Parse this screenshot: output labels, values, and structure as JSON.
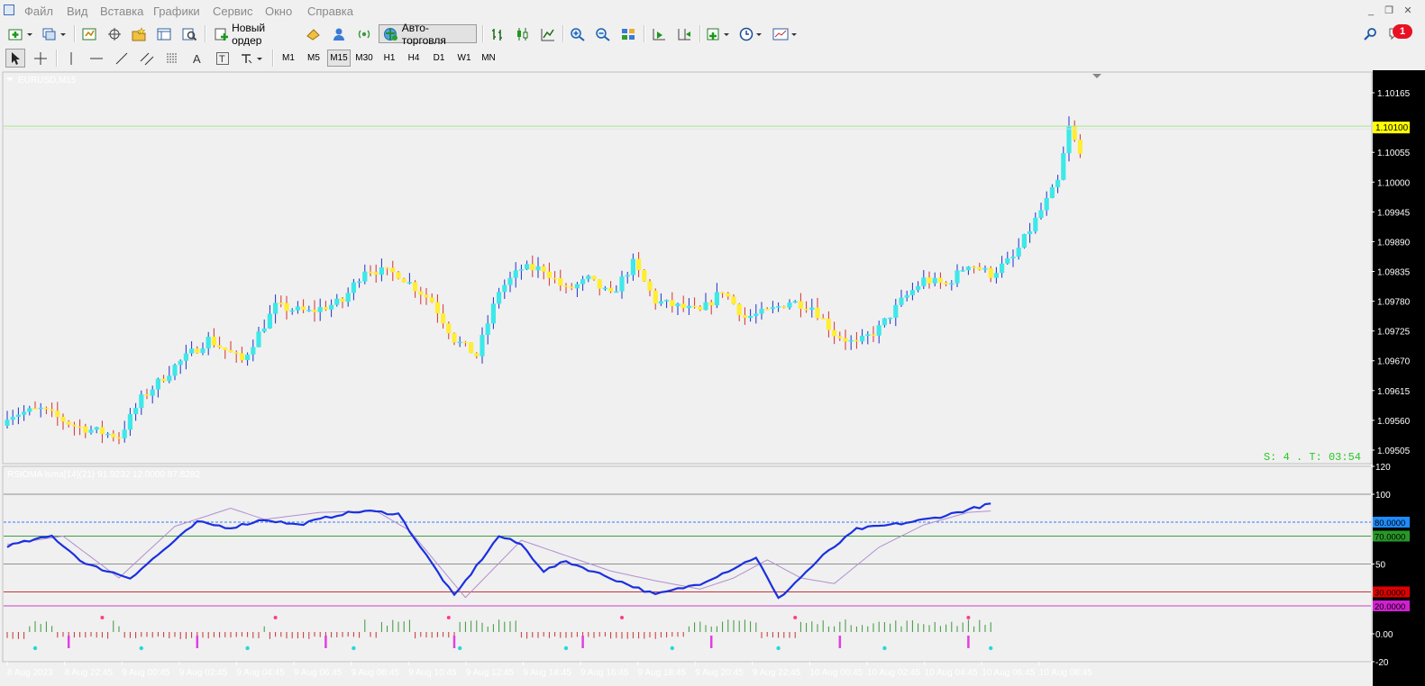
{
  "menu": [
    "Файл",
    "Вид",
    "Вставка",
    "Графики",
    "Сервис",
    "Окно",
    "Справка"
  ],
  "toolbar": {
    "new_order_label": "Новый ордер",
    "autotrading_label": "Авто-торговля",
    "notification_count": "1"
  },
  "timeframes": [
    "M1",
    "M5",
    "M15",
    "M30",
    "H1",
    "H4",
    "D1",
    "W1",
    "MN"
  ],
  "active_timeframe": "M15",
  "chart": {
    "symbol_label": "EURUSD,M15",
    "price_ticks": [
      "1.10165",
      "1.10055",
      "1.10000",
      "1.09945",
      "1.09890",
      "1.09835",
      "1.09780",
      "1.09725",
      "1.09670",
      "1.09615",
      "1.09560",
      "1.09505"
    ],
    "current_price": "1.10100",
    "price_min": 1.0948,
    "price_max": 1.102,
    "spread_timer": "S: 4 .  T: 03:54",
    "colors": {
      "bull": "#3ee8e8",
      "bear": "#ffee33",
      "bull_wick": "#2030d0",
      "bear_wick": "#d83030",
      "price_line": "#a8e890",
      "label_bg": "#ffff00"
    }
  },
  "indicator": {
    "label": "RSIOMA lsma[14](21) 91.9232 12.0000 87.8282",
    "ticks": [
      "120",
      "100",
      "50",
      "0.00",
      "-20"
    ],
    "levels": [
      {
        "value": 80,
        "label": "80.0000",
        "color": "#3878ff",
        "bg": "#1e8cff"
      },
      {
        "value": 70,
        "label": "70.0000",
        "color": "#3ca03c",
        "bg": "#289628"
      },
      {
        "value": 30,
        "label": "30.0000",
        "color": "#c83232",
        "bg": "#e00000"
      },
      {
        "value": 20,
        "label": "20.0000",
        "color": "#c840c8",
        "bg": "#d020d0"
      }
    ],
    "range": [
      -20,
      120
    ]
  },
  "time_labels": [
    "8 Aug 2023",
    "8 Aug 22:45",
    "9 Aug 00:45",
    "9 Aug 02:45",
    "9 Aug 04:45",
    "9 Aug 06:45",
    "9 Aug 08:45",
    "9 Aug 10:45",
    "9 Aug 12:45",
    "9 Aug 14:45",
    "9 Aug 16:45",
    "9 Aug 18:45",
    "9 Aug 20:45",
    "9 Aug 22:45",
    "10 Aug 00:45",
    "10 Aug 02:45",
    "10 Aug 04:45",
    "10 Aug 06:45",
    "10 Aug 08:45"
  ],
  "chart_data": {
    "type": "candlestick",
    "close_anchors": [
      [
        0,
        1.0957
      ],
      [
        6,
        1.0958
      ],
      [
        12,
        1.0955
      ],
      [
        16,
        1.0954
      ],
      [
        20,
        1.0953
      ],
      [
        24,
        1.096
      ],
      [
        30,
        1.0966
      ],
      [
        36,
        1.0971
      ],
      [
        42,
        1.0967
      ],
      [
        48,
        1.0977
      ],
      [
        54,
        1.0976
      ],
      [
        60,
        1.0978
      ],
      [
        64,
        1.0984
      ],
      [
        70,
        1.0983
      ],
      [
        76,
        1.0978
      ],
      [
        80,
        1.0971
      ],
      [
        84,
        1.0968
      ],
      [
        88,
        1.098
      ],
      [
        92,
        1.0984
      ],
      [
        96,
        1.0984
      ],
      [
        100,
        1.098
      ],
      [
        104,
        1.0982
      ],
      [
        108,
        1.0979
      ],
      [
        112,
        1.0985
      ],
      [
        116,
        1.0978
      ],
      [
        120,
        1.0977
      ],
      [
        124,
        1.0976
      ],
      [
        128,
        1.098
      ],
      [
        132,
        1.0975
      ],
      [
        136,
        1.0976
      ],
      [
        140,
        1.0978
      ],
      [
        144,
        1.0977
      ],
      [
        148,
        1.0972
      ],
      [
        152,
        1.097
      ],
      [
        156,
        1.0973
      ],
      [
        160,
        1.0978
      ],
      [
        164,
        1.0982
      ],
      [
        168,
        1.0981
      ],
      [
        172,
        1.0985
      ],
      [
        176,
        1.0983
      ],
      [
        180,
        1.0986
      ],
      [
        184,
        1.0993
      ],
      [
        188,
        1.1
      ],
      [
        190,
        1.101
      ],
      [
        192,
        1.1005
      ]
    ],
    "rsi_anchors": [
      [
        0,
        63
      ],
      [
        8,
        70
      ],
      [
        14,
        50
      ],
      [
        22,
        40
      ],
      [
        34,
        80
      ],
      [
        40,
        76
      ],
      [
        46,
        82
      ],
      [
        52,
        78
      ],
      [
        60,
        86
      ],
      [
        64,
        88
      ],
      [
        70,
        86
      ],
      [
        74,
        62
      ],
      [
        80,
        27
      ],
      [
        88,
        70
      ],
      [
        92,
        64
      ],
      [
        96,
        45
      ],
      [
        100,
        52
      ],
      [
        108,
        40
      ],
      [
        116,
        28
      ],
      [
        124,
        36
      ],
      [
        130,
        47
      ],
      [
        134,
        55
      ],
      [
        138,
        25
      ],
      [
        146,
        56
      ],
      [
        152,
        75
      ],
      [
        160,
        79
      ],
      [
        166,
        83
      ],
      [
        172,
        89
      ],
      [
        176,
        93
      ]
    ],
    "signal_anchors": [
      [
        0,
        64
      ],
      [
        10,
        70
      ],
      [
        20,
        40
      ],
      [
        30,
        77
      ],
      [
        40,
        90
      ],
      [
        46,
        82
      ],
      [
        56,
        87
      ],
      [
        66,
        88
      ],
      [
        72,
        74
      ],
      [
        82,
        26
      ],
      [
        92,
        67
      ],
      [
        100,
        56
      ],
      [
        108,
        45
      ],
      [
        116,
        38
      ],
      [
        124,
        32
      ],
      [
        130,
        40
      ],
      [
        136,
        53
      ],
      [
        142,
        40
      ],
      [
        148,
        36
      ],
      [
        156,
        62
      ],
      [
        164,
        78
      ],
      [
        172,
        87
      ],
      [
        176,
        88
      ]
    ]
  }
}
